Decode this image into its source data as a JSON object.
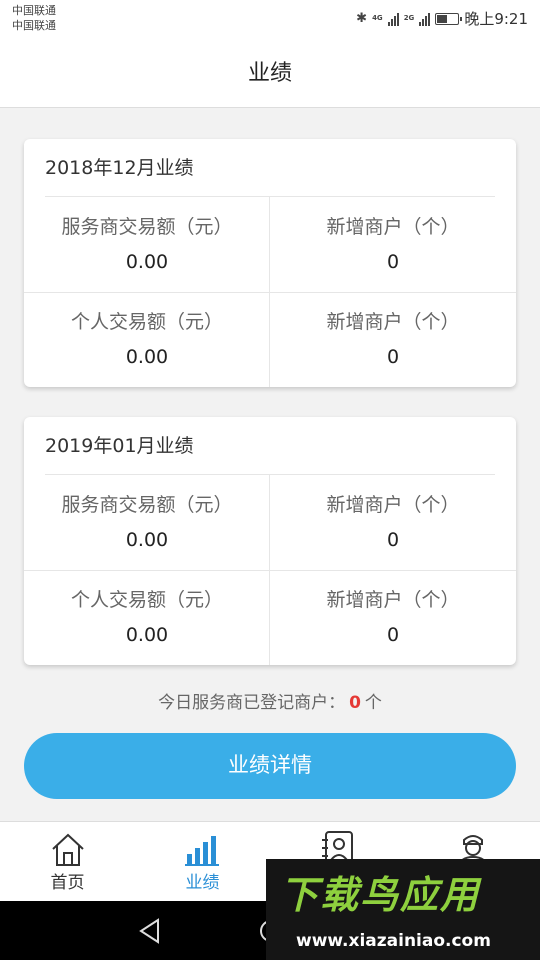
{
  "status_bar": {
    "carrier_1": "中国联通",
    "carrier_2": "中国联通",
    "net_1": "4G",
    "net_2": "2G",
    "time": "晚上9:21"
  },
  "header": {
    "title": "业绩"
  },
  "cards": [
    {
      "title": "2018年12月业绩",
      "cells": [
        {
          "label": "服务商交易额（元）",
          "value": "0.00"
        },
        {
          "label": "新增商户（个）",
          "value": "0"
        },
        {
          "label": "个人交易额（元）",
          "value": "0.00"
        },
        {
          "label": "新增商户（个）",
          "value": "0"
        }
      ]
    },
    {
      "title": "2019年01月业绩",
      "cells": [
        {
          "label": "服务商交易额（元）",
          "value": "0.00"
        },
        {
          "label": "新增商户（个）",
          "value": "0"
        },
        {
          "label": "个人交易额（元）",
          "value": "0.00"
        },
        {
          "label": "新增商户（个）",
          "value": "0"
        }
      ]
    }
  ],
  "summary": {
    "prefix": "今日服务商已登记商户：",
    "count": "0",
    "suffix": "个"
  },
  "detail_button": {
    "label": "业绩详情"
  },
  "tabs": [
    {
      "label": "首页",
      "icon": "home-icon"
    },
    {
      "label": "业绩",
      "icon": "bar-chart-icon",
      "active": true
    },
    {
      "label": "",
      "icon": "contact-card-icon"
    },
    {
      "label": "",
      "icon": "user-icon"
    }
  ],
  "watermark": {
    "brand": "下载鸟应用",
    "url": "www.xiazainiao.com"
  },
  "colors": {
    "accent": "#3aaee8",
    "active_tab": "#2a8fd6",
    "count_red": "#e53935",
    "watermark_green": "#8ed03e"
  }
}
